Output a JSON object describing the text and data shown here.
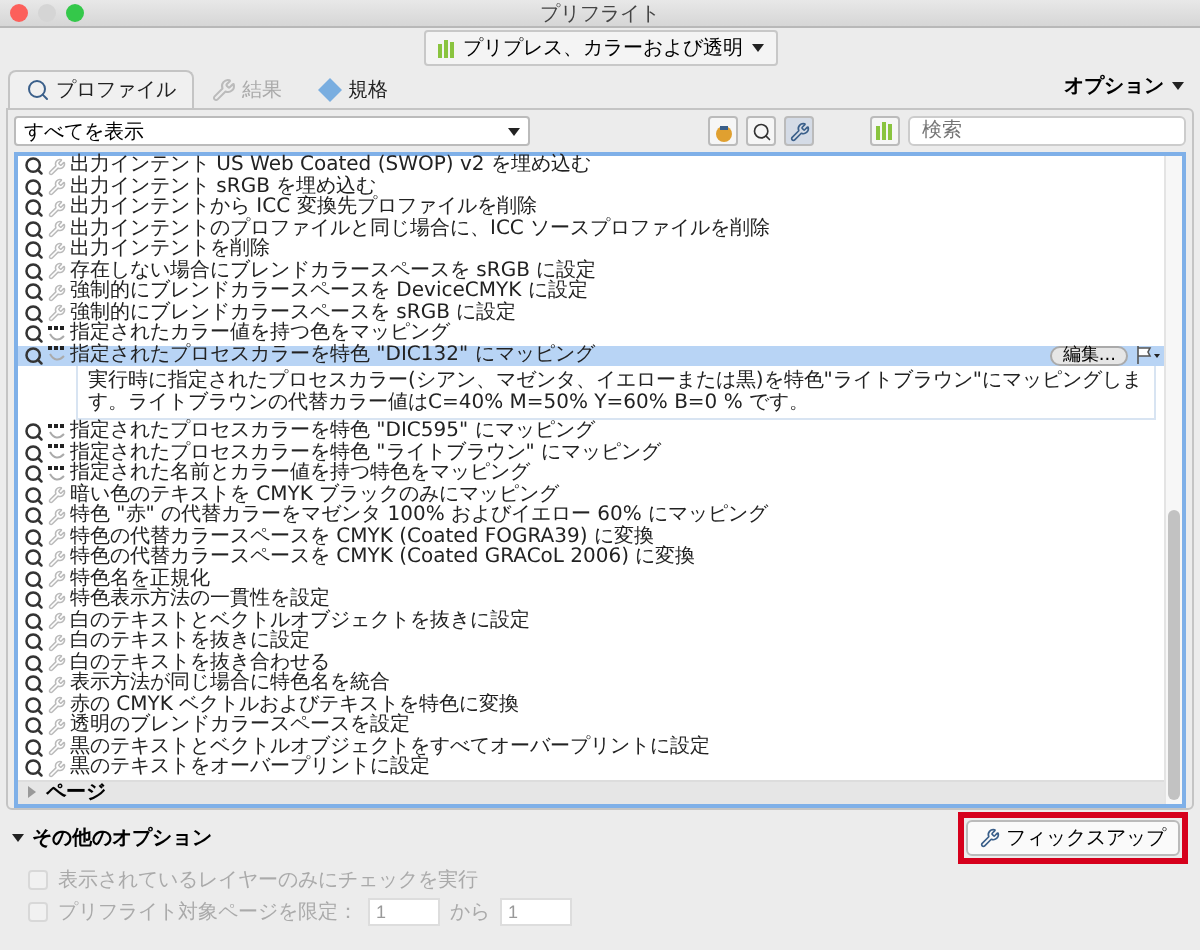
{
  "window": {
    "title": "プリフライト"
  },
  "library_menu": {
    "label": "プリプレス、カラーおよび透明"
  },
  "tabs": [
    {
      "label": "プロファイル",
      "selected": true,
      "disabled": false
    },
    {
      "label": "結果",
      "selected": false,
      "disabled": true
    },
    {
      "label": "規格",
      "selected": false,
      "disabled": false
    }
  ],
  "options_menu": {
    "label": "オプション"
  },
  "filter": {
    "value": "すべてを表示"
  },
  "search": {
    "placeholder": "検索"
  },
  "fixups": [
    {
      "label": "出力インテント US Web Coated (SWOP) v2 を埋め込む",
      "kind": "fix",
      "selected": false
    },
    {
      "label": "出力インテント sRGB を埋め込む",
      "kind": "fix",
      "selected": false
    },
    {
      "label": "出力インテントから ICC 変換先プロファイルを削除",
      "kind": "fix",
      "selected": false
    },
    {
      "label": "出力インテントのプロファイルと同じ場合に、ICC ソースプロファイルを削除",
      "kind": "fix",
      "selected": false
    },
    {
      "label": "出力インテントを削除",
      "kind": "fix",
      "selected": false
    },
    {
      "label": "存在しない場合にブレンドカラースペースを sRGB に設定",
      "kind": "fix",
      "selected": false
    },
    {
      "label": "強制的にブレンドカラースペースを DeviceCMYK に設定",
      "kind": "fix",
      "selected": false
    },
    {
      "label": "強制的にブレンドカラースペースを sRGB に設定",
      "kind": "fix",
      "selected": false
    },
    {
      "label": "指定されたカラー値を持つ色をマッピング",
      "kind": "map",
      "selected": false
    },
    {
      "label": "指定されたプロセスカラーを特色 \"DIC132\" にマッピング",
      "kind": "map",
      "selected": true,
      "edit_button": "編集...",
      "description": "実行時に指定されたプロセスカラー(シアン、マゼンタ、イエローまたは黒)を特色\"ライトブラウン\"にマッピングします。ライトブラウンの代替カラー値はC=40% M=50% Y=60% B=0 % です。"
    },
    {
      "label": "指定されたプロセスカラーを特色 \"DIC595\" にマッピング",
      "kind": "map",
      "selected": false
    },
    {
      "label": "指定されたプロセスカラーを特色 \"ライトブラウン\" にマッピング",
      "kind": "map",
      "selected": false
    },
    {
      "label": "指定された名前とカラー値を持つ特色をマッピング",
      "kind": "map",
      "selected": false
    },
    {
      "label": "暗い色のテキストを CMYK ブラックのみにマッピング",
      "kind": "fix",
      "selected": false
    },
    {
      "label": "特色 \"赤\" の代替カラーをマゼンタ 100% およびイエロー 60% にマッピング",
      "kind": "fix",
      "selected": false
    },
    {
      "label": "特色の代替カラースペースを CMYK (Coated FOGRA39) に変換",
      "kind": "fix",
      "selected": false
    },
    {
      "label": "特色の代替カラースペースを CMYK (Coated GRACoL 2006) に変換",
      "kind": "fix",
      "selected": false
    },
    {
      "label": "特色名を正規化",
      "kind": "fix",
      "selected": false
    },
    {
      "label": "特色表示方法の一貫性を設定",
      "kind": "fix",
      "selected": false
    },
    {
      "label": "白のテキストとベクトルオブジェクトを抜きに設定",
      "kind": "fix",
      "selected": false
    },
    {
      "label": "白のテキストを抜きに設定",
      "kind": "fix",
      "selected": false
    },
    {
      "label": "白のテキストを抜き合わせる",
      "kind": "fix",
      "selected": false
    },
    {
      "label": "表示方法が同じ場合に特色名を統合",
      "kind": "fix",
      "selected": false
    },
    {
      "label": "赤の CMYK ベクトルおよびテキストを特色に変換",
      "kind": "fix",
      "selected": false
    },
    {
      "label": "透明のブレンドカラースペースを設定",
      "kind": "fix",
      "selected": false
    },
    {
      "label": "黒のテキストとベクトルオブジェクトをすべてオーバープリントに設定",
      "kind": "fix",
      "selected": false
    },
    {
      "label": "黒のテキストをオーバープリントに設定",
      "kind": "fix",
      "selected": false
    }
  ],
  "pages_group": {
    "label": "ページ",
    "expanded": false
  },
  "more_options": {
    "label": "その他のオプション",
    "expanded": true,
    "checks": [
      {
        "label": "表示されているレイヤーのみにチェックを実行",
        "checked": false,
        "disabled": true
      },
      {
        "label": "プリフライト対象ページを限定：",
        "checked": false,
        "disabled": true,
        "from": "1",
        "to_label": "から",
        "to": "1"
      }
    ]
  },
  "fixup_button": {
    "label": "フィックスアップ",
    "highlighted": true
  }
}
